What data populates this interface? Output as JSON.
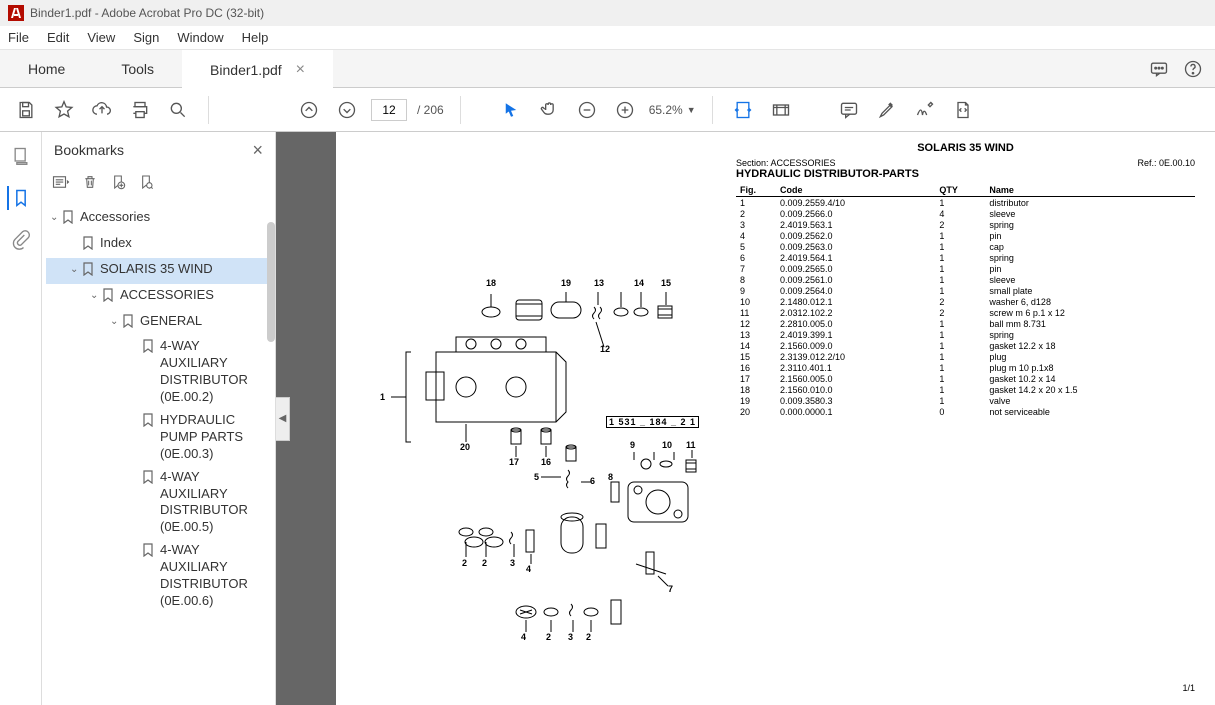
{
  "titlebar": "Binder1.pdf - Adobe Acrobat Pro DC (32-bit)",
  "menu": {
    "file": "File",
    "edit": "Edit",
    "view": "View",
    "sign": "Sign",
    "window": "Window",
    "help": "Help"
  },
  "tabs": {
    "home": "Home",
    "tools": "Tools",
    "doc": "Binder1.pdf"
  },
  "toolbar": {
    "page_current": "12",
    "page_total": "/ 206",
    "zoom": "65.2%"
  },
  "bookmarks": {
    "title": "Bookmarks",
    "tree": {
      "accessories": "Accessories",
      "index": "Index",
      "solaris": "SOLARIS 35 WIND",
      "accessories2": "ACCESSORIES",
      "general": "GENERAL",
      "n1": "4-WAY AUXILIARY DISTRIBUTOR (0E.00.2)",
      "n2": "HYDRAULIC PUMP PARTS (0E.00.3)",
      "n3": "4-WAY AUXILIARY DISTRIBUTOR (0E.00.5)",
      "n4": "4-WAY AUXILIARY DISTRIBUTOR (0E.00.6)"
    }
  },
  "doc": {
    "title": "SOLARIS 35 WIND",
    "section_label": "Section: ACCESSORIES",
    "ref_label": "Ref.: 0E.00.10",
    "subtitle": "HYDRAULIC DISTRIBUTOR-PARTS",
    "callout": "1 531 _ 184 _ 2 1",
    "th_fig": "Fig.",
    "th_code": "Code",
    "th_qty": "QTY",
    "th_name": "Name",
    "page_num": "1/1",
    "parts": [
      {
        "fig": "1",
        "code": "0.009.2559.4/10",
        "qty": "1",
        "name": "distributor"
      },
      {
        "fig": "2",
        "code": "0.009.2566.0",
        "qty": "4",
        "name": "sleeve"
      },
      {
        "fig": "3",
        "code": "2.4019.563.1",
        "qty": "2",
        "name": "spring"
      },
      {
        "fig": "4",
        "code": "0.009.2562.0",
        "qty": "1",
        "name": "pin"
      },
      {
        "fig": "5",
        "code": "0.009.2563.0",
        "qty": "1",
        "name": "cap"
      },
      {
        "fig": "6",
        "code": "2.4019.564.1",
        "qty": "1",
        "name": "spring"
      },
      {
        "fig": "7",
        "code": "0.009.2565.0",
        "qty": "1",
        "name": "pin"
      },
      {
        "fig": "8",
        "code": "0.009.2561.0",
        "qty": "1",
        "name": "sleeve"
      },
      {
        "fig": "9",
        "code": "0.009.2564.0",
        "qty": "1",
        "name": "small plate"
      },
      {
        "fig": "10",
        "code": "2.1480.012.1",
        "qty": "2",
        "name": "washer 6, d128"
      },
      {
        "fig": "11",
        "code": "2.0312.102.2",
        "qty": "2",
        "name": "screw m 6 p.1 x 12"
      },
      {
        "fig": "12",
        "code": "2.2810.005.0",
        "qty": "1",
        "name": "ball mm 8.731"
      },
      {
        "fig": "13",
        "code": "2.4019.399.1",
        "qty": "1",
        "name": "spring"
      },
      {
        "fig": "14",
        "code": "2.1560.009.0",
        "qty": "1",
        "name": "gasket 12.2 x 18"
      },
      {
        "fig": "15",
        "code": "2.3139.012.2/10",
        "qty": "1",
        "name": "plug"
      },
      {
        "fig": "16",
        "code": "2.3110.401.1",
        "qty": "1",
        "name": "plug m 10 p.1x8"
      },
      {
        "fig": "17",
        "code": "2.1560.005.0",
        "qty": "1",
        "name": "gasket 10.2 x 14"
      },
      {
        "fig": "18",
        "code": "2.1560.010.0",
        "qty": "1",
        "name": "gasket 14.2 x 20 x 1.5"
      },
      {
        "fig": "19",
        "code": "0.009.3580.3",
        "qty": "1",
        "name": "valve"
      },
      {
        "fig": "20",
        "code": "0.000.0000.1",
        "qty": "0",
        "name": "not serviceable"
      }
    ]
  }
}
